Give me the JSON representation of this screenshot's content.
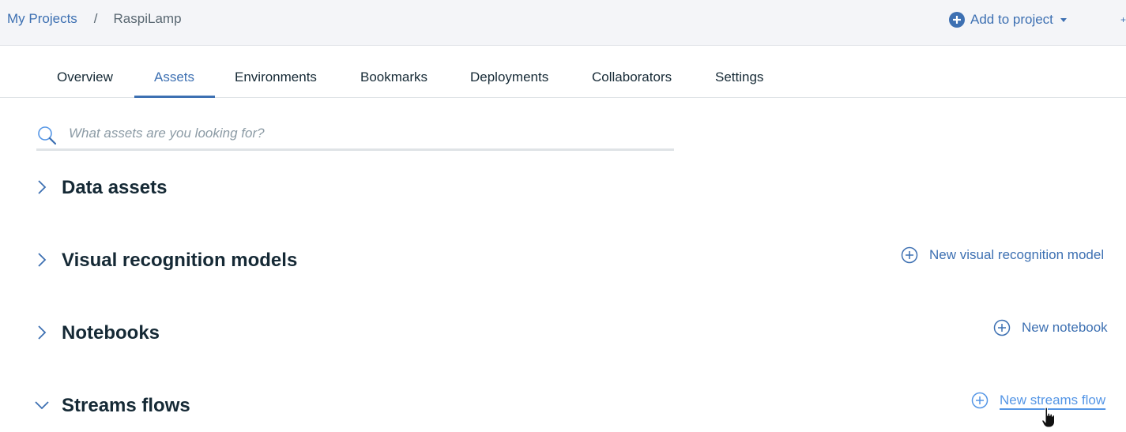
{
  "breadcrumb": {
    "root": "My Projects",
    "separator": "/",
    "current": "RaspiLamp"
  },
  "header": {
    "add_to_project_label": "Add to project"
  },
  "tabs": [
    {
      "label": "Overview",
      "active": false
    },
    {
      "label": "Assets",
      "active": true
    },
    {
      "label": "Environments",
      "active": false
    },
    {
      "label": "Bookmarks",
      "active": false
    },
    {
      "label": "Deployments",
      "active": false
    },
    {
      "label": "Collaborators",
      "active": false
    },
    {
      "label": "Settings",
      "active": false
    }
  ],
  "search": {
    "placeholder": "What assets are you looking for?",
    "value": ""
  },
  "sections": [
    {
      "title": "Data assets",
      "expanded": false,
      "action_label": ""
    },
    {
      "title": "Visual recognition models",
      "expanded": false,
      "action_label": "New visual recognition model"
    },
    {
      "title": "Notebooks",
      "expanded": false,
      "action_label": "New notebook"
    },
    {
      "title": "Streams flows",
      "expanded": true,
      "action_label": "New streams flow"
    }
  ],
  "colors": {
    "accent": "#3d70b2",
    "text": "#152935",
    "muted": "#5a6872",
    "header_bg": "#f4f5f8"
  },
  "icons": {
    "add_to_project": "plus-circle-filled-icon",
    "search": "search-icon",
    "collapsed": "chevron-right-icon",
    "expanded": "chevron-down-icon",
    "new": "plus-circle-icon",
    "cursor": "hand-pointer-icon"
  }
}
